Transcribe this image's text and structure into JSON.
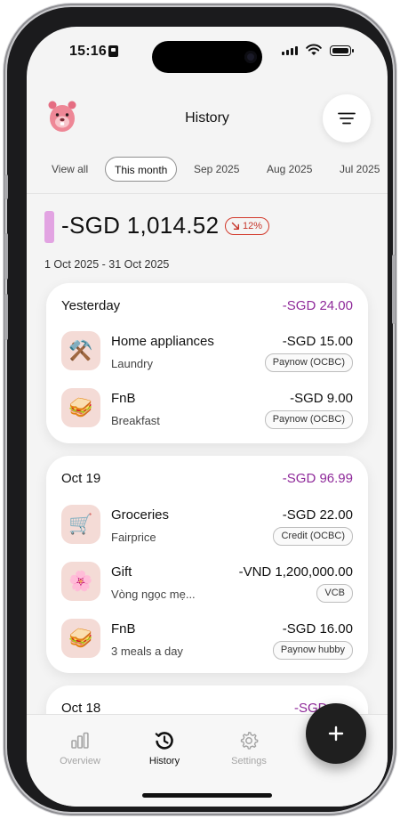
{
  "status_bar": {
    "time": "15:16"
  },
  "header": {
    "title": "History"
  },
  "tabs": [
    {
      "label": "View all"
    },
    {
      "label": "This month"
    },
    {
      "label": "Sep 2025"
    },
    {
      "label": "Aug 2025"
    },
    {
      "label": "Jul 2025"
    }
  ],
  "selected_tab": "This month",
  "summary": {
    "total": "-SGD 1,014.52",
    "change": "12%",
    "change_direction": "down",
    "date_range": "1 Oct 2025 - 31 Oct 2025",
    "accent_color": "#e2a3e2"
  },
  "groups": [
    {
      "date": "Yesterday",
      "total": "-SGD 24.00",
      "transactions": [
        {
          "icon": "tools-icon",
          "glyph": "⚒️",
          "category": "Home appliances",
          "note": "Laundry",
          "amount": "-SGD 15.00",
          "account": "Paynow (OCBC)"
        },
        {
          "icon": "sandwich-icon",
          "glyph": "🥪",
          "category": "FnB",
          "note": "Breakfast",
          "amount": "-SGD 9.00",
          "account": "Paynow (OCBC)"
        }
      ]
    },
    {
      "date": "Oct 19",
      "total": "-SGD 96.99",
      "transactions": [
        {
          "icon": "shopping-cart-icon",
          "glyph": "🛒",
          "category": "Groceries",
          "note": "Fairprice",
          "amount": "-SGD 22.00",
          "account": "Credit (OCBC)"
        },
        {
          "icon": "flower-icon",
          "glyph": "🌸",
          "category": "Gift",
          "note": "Vòng ngọc mẹ...",
          "amount": "-VND 1,200,000.00",
          "account": "VCB"
        },
        {
          "icon": "sandwich-icon",
          "glyph": "🥪",
          "category": "FnB",
          "note": "3 meals a day",
          "amount": "-SGD 16.00",
          "account": "Paynow hubby"
        }
      ]
    },
    {
      "date": "Oct 18",
      "total": "-SGD"
    }
  ],
  "bottom_nav": [
    {
      "label": "Overview",
      "icon": "bar-chart-icon"
    },
    {
      "label": "History",
      "icon": "history-icon"
    },
    {
      "label": "Settings",
      "icon": "gear-icon"
    }
  ],
  "active_nav": "History",
  "colors": {
    "group_total": "#8f2a9a",
    "change_badge": "#d2392b",
    "fab": "#1f1f1f"
  }
}
